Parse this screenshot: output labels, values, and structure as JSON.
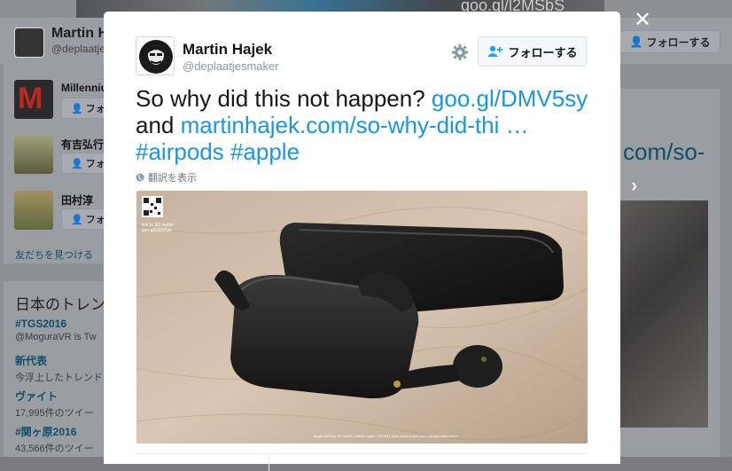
{
  "background": {
    "url_text": "goo.gl/l2MSbS",
    "profile_name": "Martin H",
    "profile_handle": "@deplaatje",
    "follow_label": "フォローする",
    "suggestions": [
      {
        "name": "Millenniu",
        "follow": "フォ"
      },
      {
        "name": "有吉弘行",
        "follow": "フォ"
      },
      {
        "name": "田村淳",
        "follow": "フォ"
      }
    ],
    "find_friends": "友だちを見つける",
    "trends_heading": "日本のトレン",
    "trends": [
      {
        "tag": "#TGS2016",
        "sub": "@MoguraVR is Tw"
      },
      {
        "tag": "新代表",
        "sub": "今浮上したトレンド"
      },
      {
        "tag": "ヴァイト",
        "sub": "17,995件のツイー"
      },
      {
        "tag": "#関ヶ原2016",
        "sub": "43,566件のツイー"
      }
    ],
    "right_link": "com/so-"
  },
  "modal": {
    "author_name": "Martin Hajek",
    "author_handle": "@deplaatjesmaker",
    "follow_label": "フォローする",
    "tweet": {
      "text1": "So why did this not happen?",
      "link1": "goo.gl/DMV5sy",
      "text2": "and",
      "link2": "martinhajek.com/so-why-did-thi …",
      "hashtag1": "#airpods",
      "hashtag2": "#apple"
    },
    "translate_label": "翻訳を表示",
    "photo": {
      "qr_caption": "link to 3D model",
      "qr_caption2": "goo.gl/DMV5sy",
      "footer": "Apple AirPods 3D model | Martin Hajek | ©2016 | www.martinhajek.com | @deplaatjesmaker"
    }
  },
  "colors": {
    "link": "#1b95e0",
    "overlay": "#8c8f93"
  },
  "icons": [
    "close-icon",
    "gear-icon",
    "follow-person-icon",
    "globe-icon"
  ]
}
